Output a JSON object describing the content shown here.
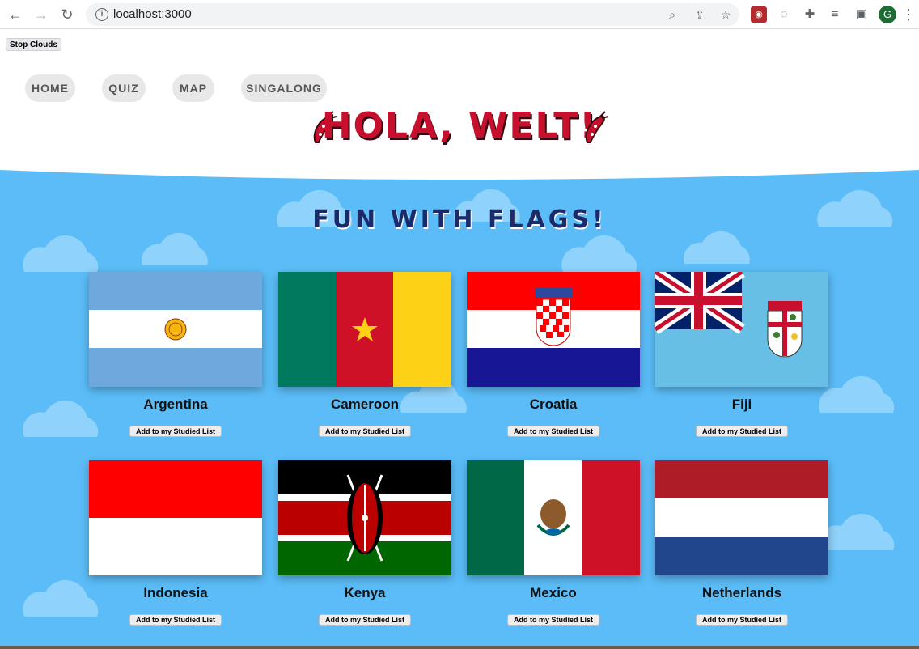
{
  "browser": {
    "url": "localhost:3000",
    "nav_icons": [
      "back-arrow-icon",
      "forward-arrow-icon",
      "reload-icon"
    ],
    "omnibox_icons": [
      "zoom-icon",
      "share-icon",
      "bookmark-star-icon"
    ],
    "extension_icons": [
      "extension-red-icon",
      "extension-face-icon",
      "puzzle-icon",
      "media-icon",
      "sidepanel-icon"
    ],
    "profile_initial": "G"
  },
  "page": {
    "stop_clouds_label": "Stop Clouds",
    "nav": [
      "HOME",
      "QUIZ",
      "MAP",
      "SINGALONG"
    ],
    "site_title": "HOLA, WELT!",
    "section_title": "FUN WITH FLAGS!",
    "add_button_label": "Add to my Studied List",
    "countries": [
      "Argentina",
      "Cameroon",
      "Croatia",
      "Fiji",
      "Indonesia",
      "Kenya",
      "Mexico",
      "Netherlands"
    ]
  },
  "colors": {
    "sky": "#5bbcf7",
    "cloud": "#8fd2fb",
    "title_red": "#c8102e",
    "section_navy": "#1b2a6b"
  }
}
